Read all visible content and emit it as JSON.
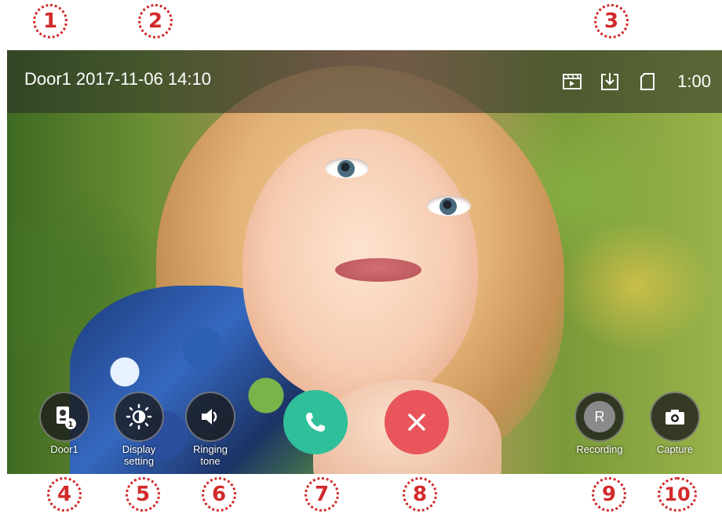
{
  "callouts": [
    "1",
    "2",
    "3",
    "4",
    "5",
    "6",
    "7",
    "8",
    "9",
    "10"
  ],
  "header": {
    "door_name": "Door1",
    "datetime": "2017-11-06 14:10",
    "elapsed_time": "1:00",
    "status_icons": [
      "video-record-icon",
      "download-icon",
      "sd-card-icon"
    ]
  },
  "controls": {
    "door": {
      "label": "Door1",
      "icon": "door-station-icon",
      "badge": "1"
    },
    "display": {
      "label": "Display\nsetting",
      "icon": "brightness-icon"
    },
    "ringtone": {
      "label": "Ringing\ntone",
      "icon": "speaker-icon"
    },
    "answer": {
      "icon": "phone-answer-icon",
      "color": "#2fbf9a"
    },
    "hangup": {
      "icon": "close-icon",
      "color": "#e8555a"
    },
    "recording": {
      "label": "Recording",
      "letter": "R"
    },
    "capture": {
      "label": "Capture",
      "icon": "camera-icon"
    }
  },
  "colors": {
    "callout": "#d22a2a",
    "answer": "#2fbf9a",
    "hangup": "#e8555a"
  }
}
